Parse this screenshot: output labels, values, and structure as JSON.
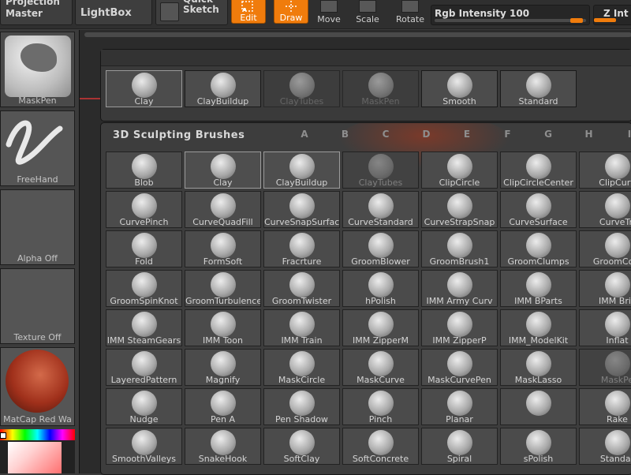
{
  "toolbar": {
    "projection_master": "Projection Master",
    "lightbox": "LightBox",
    "quick_sketch": "Quick Sketch",
    "edit": "Edit",
    "draw": "Draw",
    "move": "Move",
    "scale": "Scale",
    "rotate": "Rotate",
    "rgb_intensity_label": "Rgb Intensity 100",
    "z_intensity_label": "Z Int",
    "accent_color": "#f07c0c"
  },
  "shelf": {
    "brush": "MaskPen",
    "stroke": "FreeHand",
    "alpha": "Alpha Off",
    "texture": "Texture Off",
    "material": "MatCap Red Wa"
  },
  "recent": [
    "Clay",
    "ClayBuildup",
    "ClayTubes",
    "MaskPen",
    "Smooth",
    "Standard"
  ],
  "panel": {
    "title": "3D Sculpting Brushes",
    "letters": [
      "A",
      "B",
      "C",
      "D",
      "E",
      "F",
      "G",
      "H",
      "I"
    ],
    "rows": [
      [
        "Blob",
        "Clay",
        "ClayBuildup",
        "ClayTubes",
        "ClipCircle",
        "ClipCircleCenter",
        "ClipCurv"
      ],
      [
        "CurvePinch",
        "CurveQuadFill",
        "CurveSnapSurfac",
        "CurveStandard",
        "CurveStrapSnap",
        "CurveSurface",
        "CurveTri"
      ],
      [
        "Fold",
        "FormSoft",
        "Fracrture",
        "GroomBlower",
        "GroomBrush1",
        "GroomClumps",
        "GroomColo"
      ],
      [
        "GroomSpinKnot",
        "GroomTurbulence",
        "GroomTwister",
        "hPolish",
        "IMM Army Curv",
        "IMM BParts",
        "IMM Bric"
      ],
      [
        "IMM SteamGears",
        "IMM Toon",
        "IMM Train",
        "IMM ZipperM",
        "IMM ZipperP",
        "IMM_ModelKit",
        "Inflat"
      ],
      [
        "LayeredPattern",
        "Magnify",
        "MaskCircle",
        "MaskCurve",
        "MaskCurvePen",
        "MaskLasso",
        "MaskPe"
      ],
      [
        "Nudge",
        "Pen A",
        "Pen Shadow",
        "Pinch",
        "Planar",
        "",
        "Rake"
      ],
      [
        "SmoothValleys",
        "SnakeHook",
        "SoftClay",
        "SoftConcrete",
        "Spiral",
        "sPolish",
        "Standar"
      ]
    ]
  }
}
